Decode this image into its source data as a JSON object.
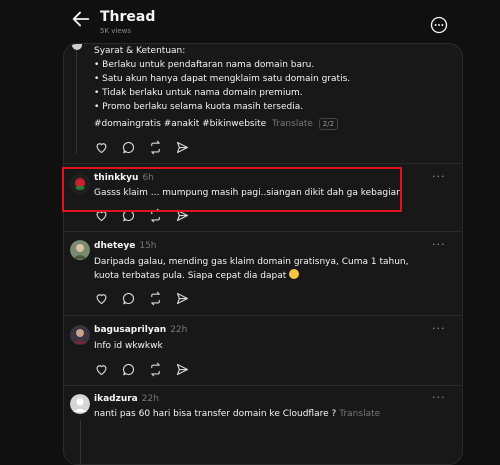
{
  "header": {
    "title": "Thread",
    "views": "5K views"
  },
  "post": {
    "lines": [
      "Syarat & Ketentuan:",
      "• Berlaku untuk pendaftaran nama domain baru.",
      "• Satu akun hanya dapat mengklaim satu domain gratis.",
      "• Tidak berlaku untuk nama domain premium.",
      "• Promo berlaku selama kuota masih tersedia."
    ],
    "hashtags": "#domaingratis #anakit #bikinwebsite",
    "translate_label": "Translate",
    "page_count": "2/2"
  },
  "replies": [
    {
      "username": "thinkkyu",
      "time": "6h",
      "text": "Gasss klaim ... mumpung masih pagi..siangan dikit dah ga kebagian"
    },
    {
      "username": "dheteye",
      "time": "15h",
      "text": "Daripada galau, mending gas klaim domain gratisnya, Cuma 1 tahun, kuota terbatas pula. Siapa cepat dia dapat"
    },
    {
      "username": "bagusaprilyan",
      "time": "22h",
      "text": "Info id wkwkwk"
    },
    {
      "username": "ikadzura",
      "time": "22h",
      "text": "nanti pas 60 hari bisa transfer domain ke Cloudflare ?",
      "translate_label": "Translate"
    }
  ],
  "icons": {
    "back": "arrow-left-icon",
    "more": "more-circle-icon",
    "like": "heart-icon",
    "reply": "comment-icon",
    "repost": "repost-icon",
    "share": "send-icon"
  },
  "colors": {
    "background": "#101010",
    "card": "#181818",
    "highlight": "#e0141c"
  }
}
